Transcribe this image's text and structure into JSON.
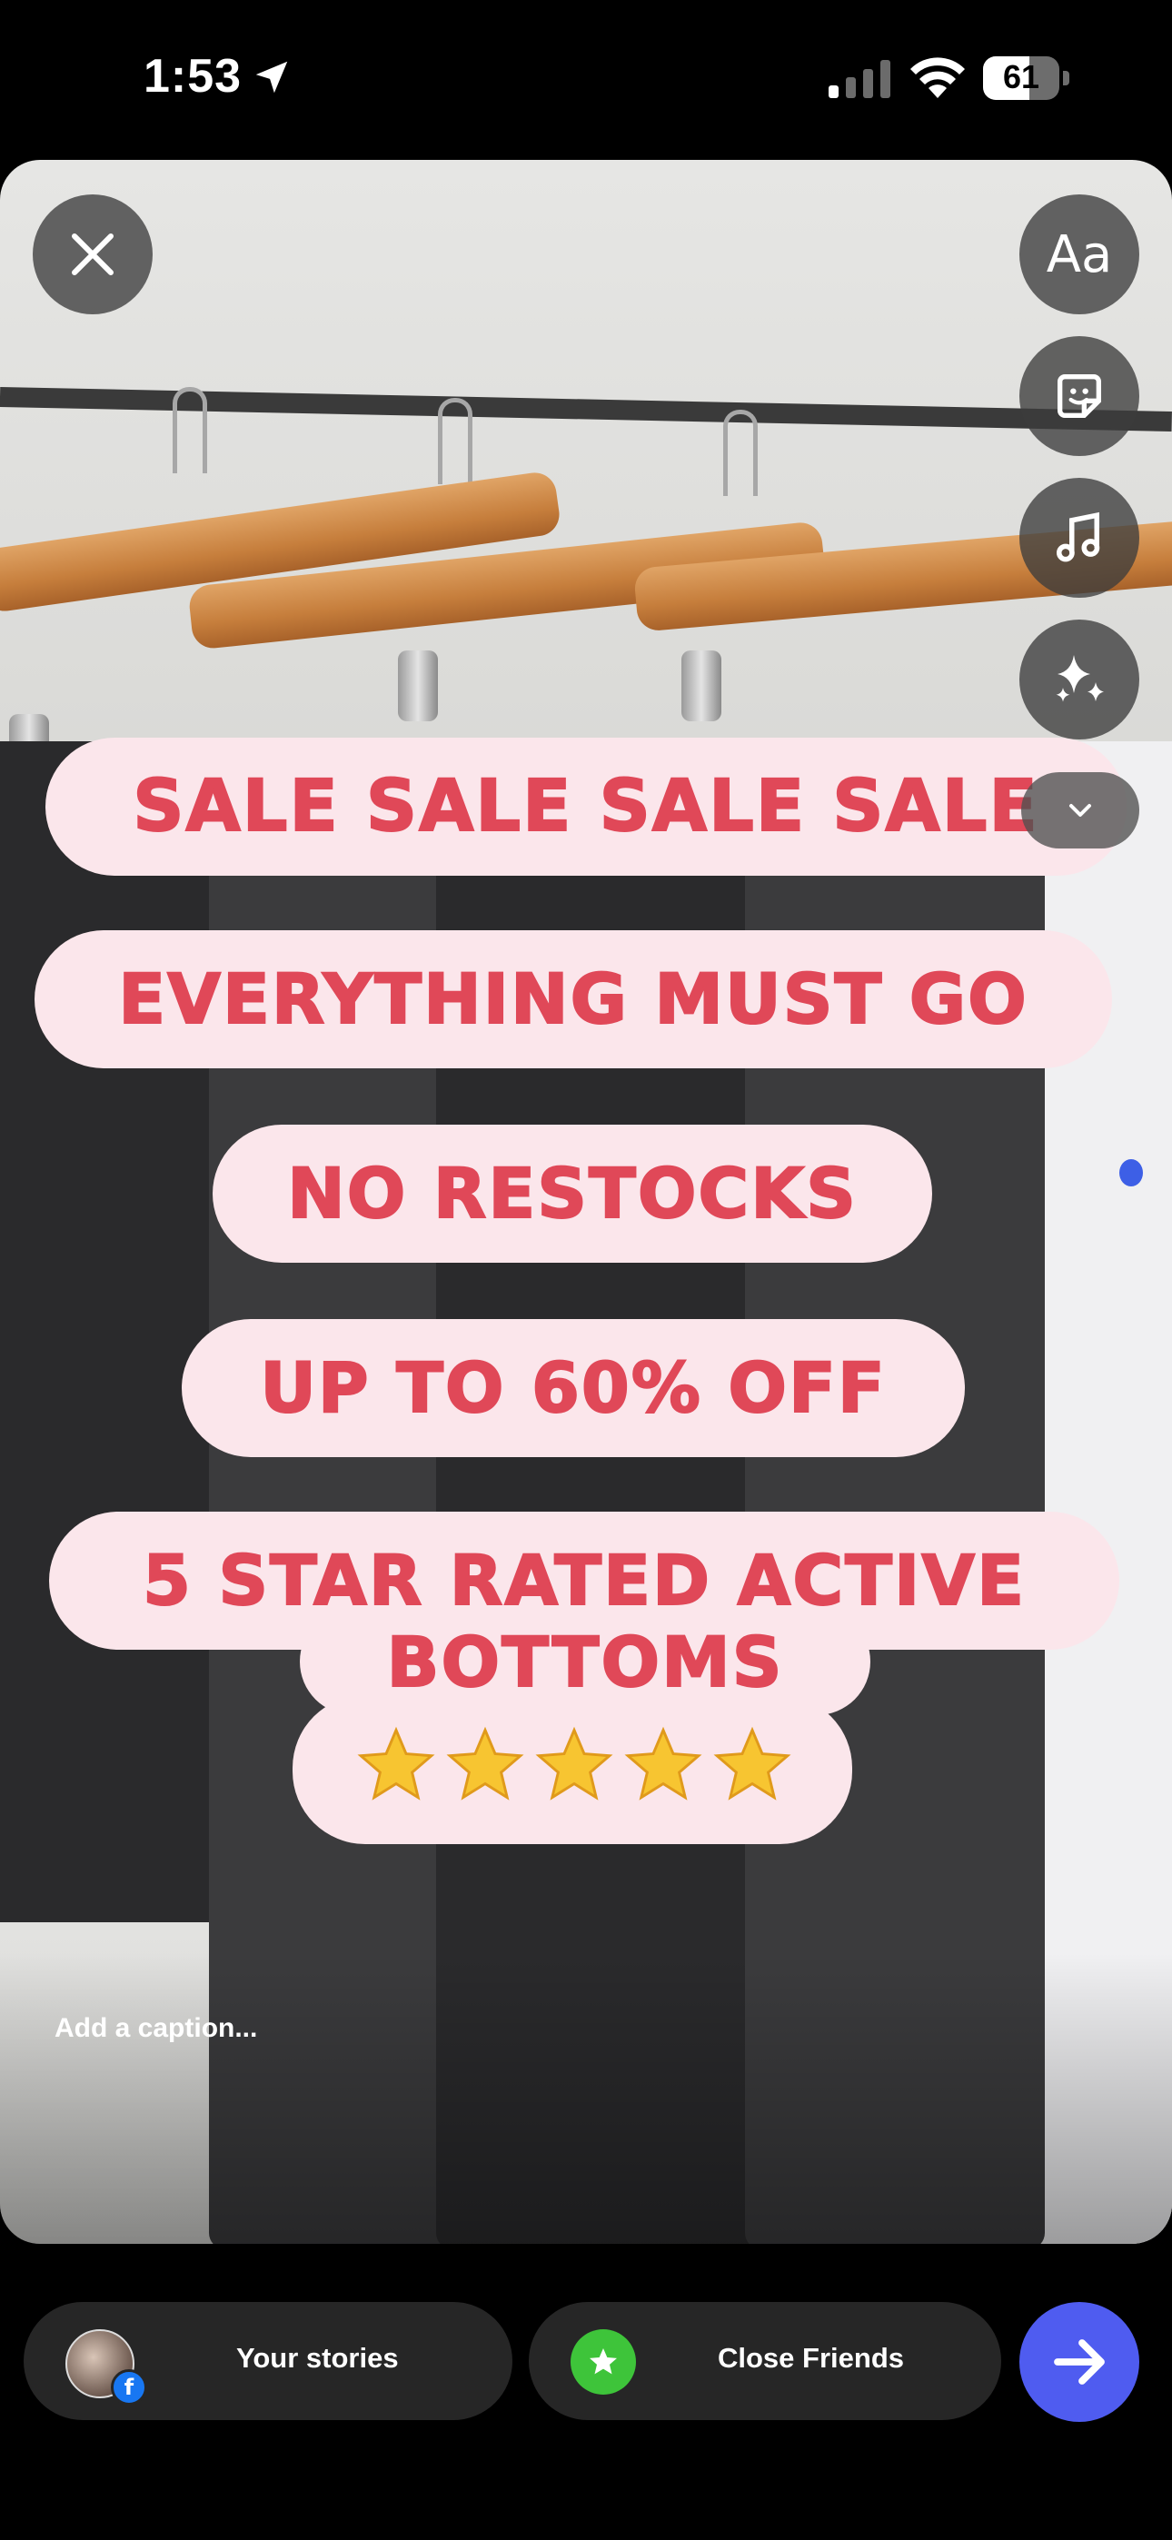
{
  "status_bar": {
    "time": "1:53",
    "battery_percent": "61",
    "icons": [
      "location-arrow-icon",
      "cellular-signal-icon",
      "wifi-icon",
      "battery-icon"
    ]
  },
  "editor": {
    "tools": {
      "text_button_label": "Aa",
      "icons": [
        "close-icon",
        "sticker-icon",
        "music-note-icon",
        "sparkles-icon",
        "chevron-down-icon"
      ]
    },
    "stickers": [
      "SALE SALE SALE SALE",
      "EVERYTHING MUST GO",
      "NO RESTOCKS",
      "UP TO 60% OFF",
      "5 STAR RATED ACTIVE",
      "BOTTOMS"
    ],
    "star_count": 5,
    "caption_placeholder": "Add a caption..."
  },
  "share_bar": {
    "your_stories_label": "Your stories",
    "close_friends_label": "Close Friends",
    "send_icon": "arrow-right-icon",
    "colors": {
      "send": "#4f5cf0",
      "close_friends": "#3ec43a",
      "facebook": "#1877f2"
    }
  }
}
